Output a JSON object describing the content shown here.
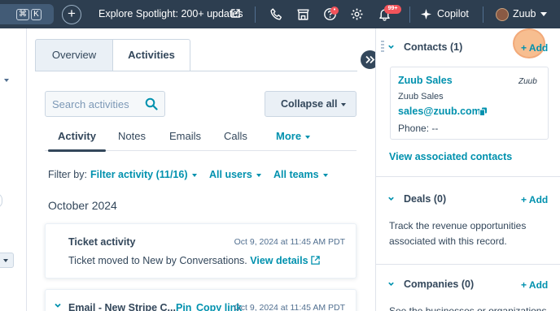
{
  "topbar": {
    "kbd1": "⌘",
    "kbd2": "K",
    "plus": "+",
    "spotlight": "Explore Spotlight: 200+ updates",
    "notif_count": "99+",
    "copilot": "Copilot",
    "user": "Zuub"
  },
  "tabs": {
    "overview": "Overview",
    "activities": "Activities"
  },
  "search": {
    "placeholder": "Search activities"
  },
  "collapse": "Collapse all",
  "subtabs": {
    "activity": "Activity",
    "notes": "Notes",
    "emails": "Emails",
    "calls": "Calls",
    "more": "More"
  },
  "filters": {
    "label": "Filter by:",
    "activity": "Filter activity (11/16)",
    "users": "All users",
    "teams": "All teams"
  },
  "month": "October 2024",
  "activities": [
    {
      "title": "Ticket activity",
      "date": "Oct 9, 2024 at 11:45 AM PDT",
      "body": "Ticket moved to New by Conversations.",
      "link": "View details"
    },
    {
      "title": "Email - New Stripe C...",
      "pin": "Pin",
      "copy": "Copy link",
      "date": "Oct 9, 2024 at 11:45 AM PDT"
    }
  ],
  "sidebar": {
    "contacts": {
      "title": "Contacts (1)",
      "add": "+ Add",
      "card": {
        "name": "Zuub Sales",
        "company": "Zuub Sales",
        "email": "sales@zuub.com",
        "phone": "Phone: --",
        "logo": "Zuub"
      },
      "view_all": "View associated contacts"
    },
    "deals": {
      "title": "Deals (0)",
      "add": "+ Add",
      "desc": "Track the revenue opportunities associated with this record."
    },
    "companies": {
      "title": "Companies (0)",
      "add": "+ Add",
      "desc": "See the businesses or organizations"
    }
  },
  "colors": {
    "nav_bg": "#2d3e50",
    "link": "#0091ae",
    "text": "#33475b",
    "highlight": "#f5a96c",
    "badge": "#f2545b"
  }
}
